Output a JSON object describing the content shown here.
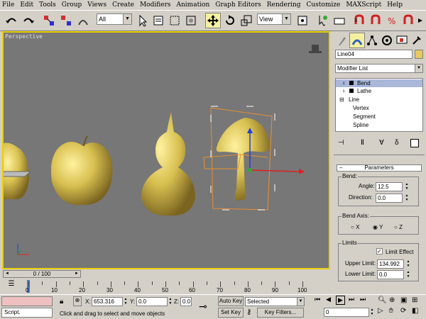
{
  "menu": [
    "File",
    "Edit",
    "Tools",
    "Group",
    "Views",
    "Create",
    "Modifiers",
    "Animation",
    "Graph Editors",
    "Rendering",
    "Customize",
    "MAXScript",
    "Help"
  ],
  "toolbar": {
    "selection_filter": "All",
    "ref_coord": "View"
  },
  "viewport": {
    "label": "Perspective"
  },
  "command_panel": {
    "object_name": "Line04",
    "modifier_list": "Modifier List",
    "stack": [
      {
        "label": "Bend",
        "selected": true,
        "level": 0,
        "bulb": true
      },
      {
        "label": "Lathe",
        "selected": false,
        "level": 0,
        "bulb": true
      },
      {
        "label": "Line",
        "selected": false,
        "level": 0,
        "bulb": false
      },
      {
        "label": "Vertex",
        "selected": false,
        "level": 1,
        "bulb": false
      },
      {
        "label": "Segment",
        "selected": false,
        "level": 1,
        "bulb": false
      },
      {
        "label": "Spline",
        "selected": false,
        "level": 1,
        "bulb": false
      }
    ],
    "rollout_title": "Parameters",
    "bend": {
      "group": "Bend:",
      "angle_label": "Angle:",
      "angle": "12.5",
      "direction_label": "Direction:",
      "direction": "0.0"
    },
    "bend_axis": {
      "group": "Bend Axis:",
      "x": "X",
      "y": "Y",
      "z": "Z",
      "selected": "Y"
    },
    "limits": {
      "group": "Limits",
      "limit_effect": "Limit Effect",
      "limit_effect_checked": true,
      "upper_label": "Upper Limit:",
      "upper": "134.992",
      "lower_label": "Lower Limit:",
      "lower": "0.0"
    }
  },
  "time_slider": {
    "label": "0 / 100",
    "ticks": [
      "0",
      "10",
      "20",
      "30",
      "40",
      "50",
      "60",
      "70",
      "80",
      "90",
      "100"
    ]
  },
  "status": {
    "script": "Script.",
    "prompt": "Click and drag to select and move objects",
    "x_label": "X:",
    "x": "653.316",
    "y_label": "Y:",
    "y": "0.0",
    "z_label": "Z:",
    "z": "0.0",
    "auto_key": "Auto Key",
    "set_key": "Set Key",
    "selected": "Selected",
    "key_filters": "Key Filters...",
    "frame": "0"
  },
  "colors": {
    "object": "#d8c050",
    "viewport_bg": "#777777",
    "active_border": "#e8d000",
    "selection_box": "#ffffff",
    "gizmo": "#e89030"
  }
}
